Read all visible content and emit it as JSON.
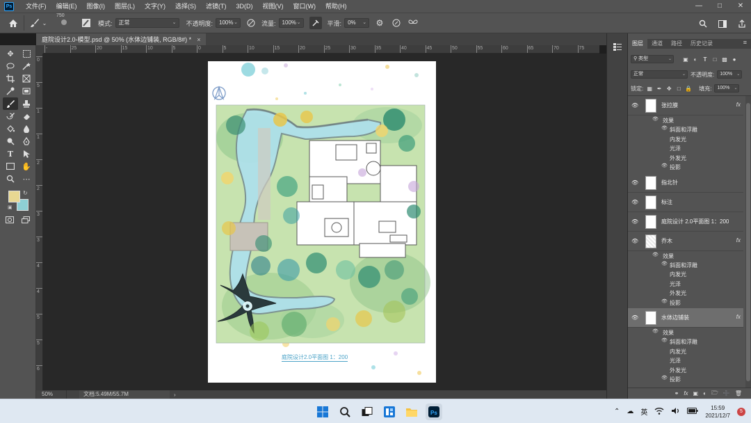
{
  "app": {
    "logo": "Ps"
  },
  "menu": [
    "文件(F)",
    "编辑(E)",
    "图像(I)",
    "图层(L)",
    "文字(Y)",
    "选择(S)",
    "滤镜(T)",
    "3D(D)",
    "视图(V)",
    "窗口(W)",
    "帮助(H)"
  ],
  "options": {
    "brush_size": "750",
    "mode_label": "模式:",
    "mode_value": "正常",
    "opacity_label": "不透明度:",
    "opacity_value": "100%",
    "flow_label": "流量:",
    "flow_value": "100%",
    "smoothing_label": "平滑:",
    "smoothing_value": "0%"
  },
  "tab": {
    "title": "庭院设计2.0-模型.psd @ 50% (水体边铺装, RGB/8#) *",
    "close": "×"
  },
  "ruler_h": [
    "-",
    "25",
    "20",
    "15",
    "10",
    "5",
    "0",
    "5",
    "10",
    "15",
    "20",
    "25",
    "30",
    "35",
    "40",
    "45",
    "50",
    "55",
    "60",
    "65",
    "70",
    "75"
  ],
  "ruler_v": [
    "0",
    "5",
    "1",
    "1",
    "2",
    "2",
    "3",
    "3",
    "4",
    "4",
    "5",
    "5",
    "6"
  ],
  "canvas": {
    "caption": "庭院设计2.0平面图 1：200"
  },
  "status": {
    "zoom": "50%",
    "doc": "文档:5.49M/55.7M",
    "arrow": "›"
  },
  "colors": {
    "foreground": "#e8d892",
    "background": "#8ecfd4",
    "accent": "#31a8ff"
  },
  "panel": {
    "tabs": [
      "图层",
      "通道",
      "路径",
      "历史记录"
    ],
    "menu": "≡",
    "filter_label": "类型",
    "blend_mode": "正常",
    "opacity_label": "不透明度:",
    "opacity_value": "100%",
    "lock_label": "锁定:",
    "fill_label": "填充:",
    "fill_value": "100%"
  },
  "layers": [
    {
      "name": "张拉膜",
      "fx": "fx",
      "effects": {
        "title": "效果",
        "items": [
          "斜面和浮雕",
          "内发光",
          "光泽",
          "外发光",
          "投影"
        ]
      }
    },
    {
      "name": "指北针"
    },
    {
      "name": "标注"
    },
    {
      "name": "庭院设计 2.0平面图 1：200"
    },
    {
      "name": "乔木",
      "fx": "fx",
      "effects": {
        "title": "效果",
        "items": [
          "斜面和浮雕",
          "内发光",
          "光泽",
          "外发光",
          "投影"
        ]
      }
    },
    {
      "name": "水体边铺装",
      "fx": "fx",
      "selected": true,
      "effects": {
        "title": "效果",
        "items": [
          "斜面和浮雕",
          "内发光",
          "光泽",
          "外发光",
          "投影"
        ]
      }
    }
  ],
  "taskbar": {
    "lang": "英",
    "time": "15:59",
    "date": "2021/12/7",
    "notifications": "5"
  }
}
